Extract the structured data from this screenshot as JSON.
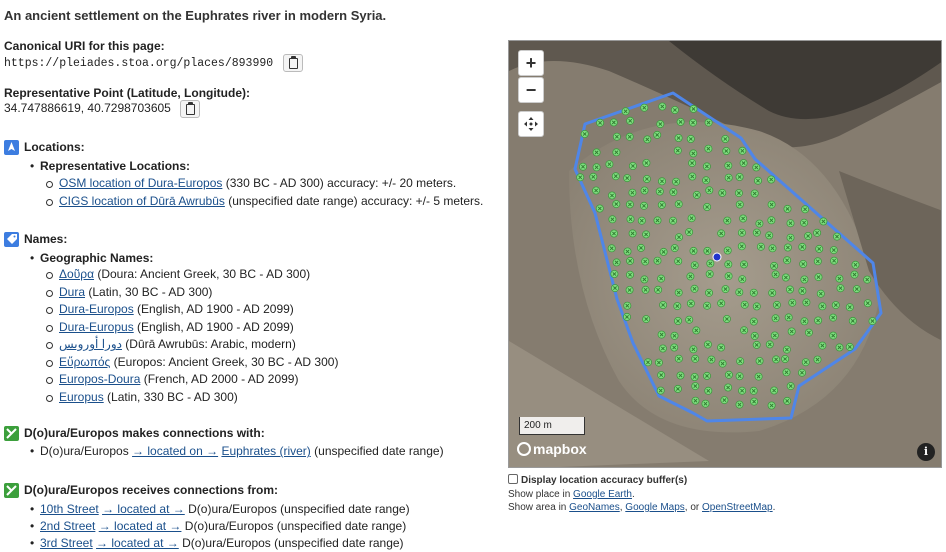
{
  "description": "An ancient settlement on the Euphrates river in modern Syria.",
  "canonical": {
    "label": "Canonical URI for this page:",
    "uri": "https://pleiades.stoa.org/places/893990"
  },
  "repr_point": {
    "label": "Representative Point (Latitude, Longitude):",
    "value": "34.747886619, 40.7298703605"
  },
  "locations": {
    "title": "Locations:",
    "group_label": "Representative Locations:",
    "items": [
      {
        "link": "OSM location of Dura-Europos",
        "rest": " (330 BC - AD 300) accuracy: +/- 20 meters."
      },
      {
        "link": "CIGS location of Dūrā Awrubūs",
        "rest": " (unspecified date range) accuracy: +/- 5 meters."
      }
    ]
  },
  "names": {
    "title": "Names:",
    "group_label": "Geographic Names:",
    "items": [
      {
        "link": "Δοῦρα",
        "rest": " (Doura: Ancient Greek, 30 BC - AD 300)"
      },
      {
        "link": "Dura",
        "rest": " (Latin, 30 BC - AD 300)"
      },
      {
        "link": "Dura-Europos",
        "rest": " (English, AD 1900 - AD 2099)"
      },
      {
        "link": "Dura-Europus",
        "rest": " (English, AD 1900 - AD 2099)"
      },
      {
        "link": "دورا أوروبس",
        "rest": " (Dūrā Awrubūs: Arabic, modern)"
      },
      {
        "link": "Εὔρωπός",
        "rest": " (Europos: Ancient Greek, 30 BC - AD 300)"
      },
      {
        "link": "Europos-Doura",
        "rest": " (French, AD 2000 - AD 2099)"
      },
      {
        "link": "Europus",
        "rest": " (Latin, 330 BC - AD 300)"
      }
    ]
  },
  "connections_with": {
    "title": "D(o)ura/Europos makes connections with:",
    "items": [
      {
        "subject": "D(o)ura/Europos ",
        "relation": "→ located on →",
        "target": "Euphrates (river)",
        "rest": " (unspecified date range)"
      }
    ]
  },
  "connections_from": {
    "title": "D(o)ura/Europos receives connections from:",
    "items": [
      {
        "source": "10th Street",
        "relation": "→ located at →",
        "rest": " D(o)ura/Europos (unspecified date range)"
      },
      {
        "source": "2nd Street",
        "relation": "→ located at →",
        "rest": " D(o)ura/Europos (unspecified date range)"
      },
      {
        "source": "3rd Street",
        "relation": "→ located at →",
        "rest": " D(o)ura/Europos (unspecified date range)"
      }
    ]
  },
  "map": {
    "zoom_in": "+",
    "zoom_out": "−",
    "scale": "200 m",
    "logo": "mapbox",
    "info": "i",
    "colors": {
      "polygon": "#4f86e8",
      "marker": "#7fdc7f",
      "center": "#2233cc"
    }
  },
  "map_footer": {
    "checkbox_label": "Display location accuracy buffer(s)",
    "show_place_prefix": "Show place in ",
    "google_earth": "Google Earth",
    "show_place_suffix": ".",
    "show_area_prefix": "Show area in ",
    "geonames": "GeoNames",
    "sep1": ", ",
    "google_maps": "Google Maps",
    "sep2": ", or ",
    "osm": "OpenStreetMap",
    "show_area_suffix": "."
  }
}
